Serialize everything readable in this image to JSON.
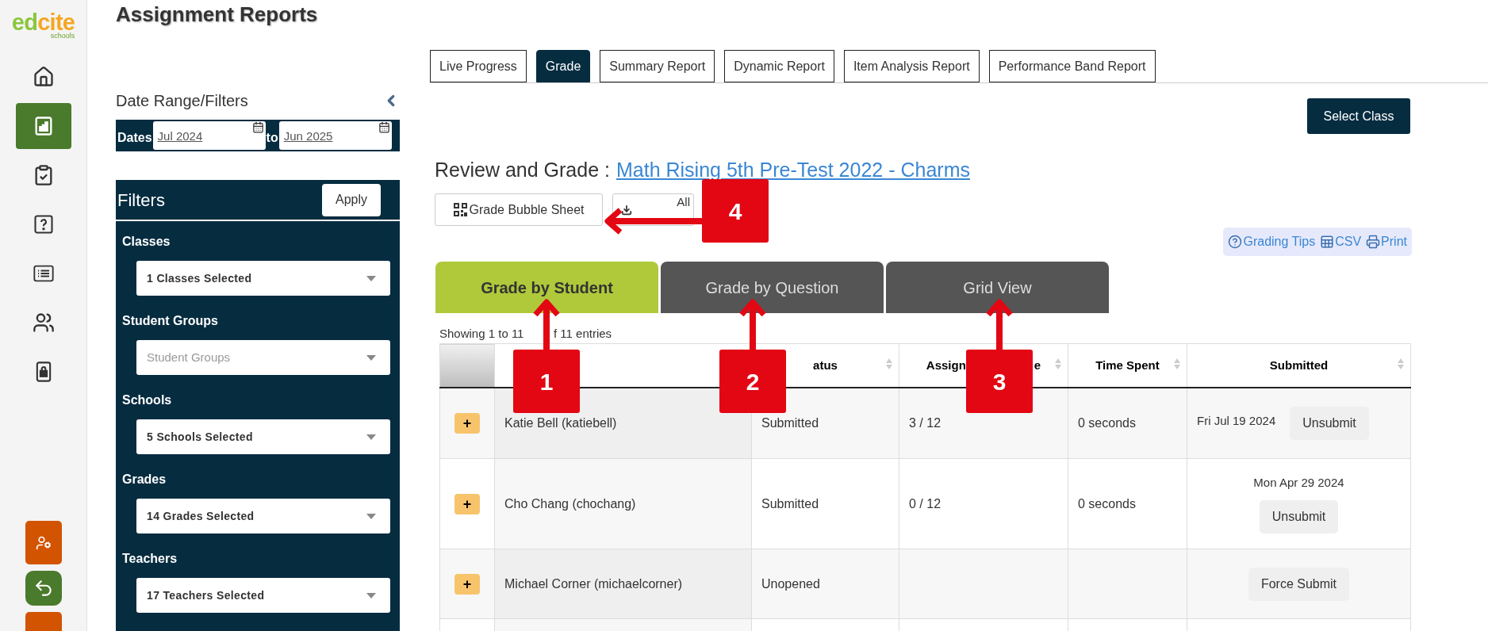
{
  "logo": {
    "name": "edcite",
    "tagline": "schools"
  },
  "sidebar": {
    "items": [
      {
        "selected": false
      },
      {
        "selected": true
      },
      {
        "selected": false
      },
      {
        "selected": false
      },
      {
        "selected": false
      },
      {
        "selected": false
      },
      {
        "selected": false
      }
    ]
  },
  "page_title": "Assignment Reports",
  "filters_panel": {
    "title": "Date Range/Filters",
    "dates_label": "Dates",
    "date_from": "Jul 2024",
    "date_to_label": "to",
    "date_to": "Jun 2025",
    "filters_title": "Filters",
    "apply_button": "Apply",
    "groups": [
      {
        "label": "Classes",
        "value": "1 Classes Selected"
      },
      {
        "label": "Student Groups",
        "placeholder": "Student Groups"
      },
      {
        "label": "Schools",
        "value": "5 Schools Selected"
      },
      {
        "label": "Grades",
        "value": "14 Grades Selected"
      },
      {
        "label": "Teachers",
        "value": "17 Teachers Selected"
      }
    ]
  },
  "report_tabs": [
    {
      "label": "Live Progress",
      "selected": false
    },
    {
      "label": "Grade",
      "selected": true
    },
    {
      "label": "Summary Report",
      "selected": false
    },
    {
      "label": "Dynamic Report",
      "selected": false
    },
    {
      "label": "Item Analysis Report",
      "selected": false
    },
    {
      "label": "Performance Band Report",
      "selected": false
    }
  ],
  "select_class_button": "Select Class",
  "review_heading": {
    "prefix": "Review and Grade :",
    "link": "Math Rising 5th Pre-Test 2022 - Charms"
  },
  "grade_bubble_sheet_button": "Grade Bubble Sheet",
  "open_all_button": {
    "visible_text": "All"
  },
  "tools": [
    {
      "kind": "help",
      "label": "Grading Tips"
    },
    {
      "kind": "sheet",
      "label": "CSV"
    },
    {
      "kind": "printer",
      "label": "Print"
    }
  ],
  "view_tabs": [
    {
      "label": "Grade by Student",
      "selected": true
    },
    {
      "label": "Grade by Question",
      "selected": false
    },
    {
      "label": "Grid View",
      "selected": false
    }
  ],
  "entries_info": [
    "Showing 1 to 11",
    "f 11 entries"
  ],
  "table": {
    "columns": [
      {
        "kind": "select",
        "sortable": false
      },
      {
        "kind": "blank",
        "sortable": false
      },
      {
        "kind": "text",
        "label": "atus",
        "sortable": true
      },
      {
        "kind": "split",
        "parts": [
          "Assign",
          "e"
        ],
        "sortable": true
      },
      {
        "kind": "text",
        "label": "Time Spent",
        "sortable": true
      },
      {
        "kind": "text",
        "label": "Submitted",
        "sortable": true
      }
    ],
    "rows": [
      {
        "expand": "+",
        "student": "Katie Bell (katiebell)",
        "status": "Submitted",
        "score": "3 / 12",
        "time_spent": "0 seconds",
        "submitted": {
          "kind": "inline",
          "date": "Fri Jul 19 2024",
          "action": "Unsubmit"
        }
      },
      {
        "expand": "+",
        "student": "Cho Chang (chochang)",
        "status": "Submitted",
        "score": "0 / 12",
        "time_spent": "0 seconds",
        "submitted": {
          "kind": "stacked",
          "date": "Mon Apr 29 2024",
          "action": "Unsubmit"
        }
      },
      {
        "expand": "+",
        "student": "Michael Corner (michaelcorner)",
        "status": "Unopened",
        "submitted": {
          "kind": "action",
          "action": "Force Submit"
        }
      }
    ]
  },
  "callouts": [
    {
      "number": "1"
    },
    {
      "number": "2"
    },
    {
      "number": "3"
    },
    {
      "number": "4"
    }
  ]
}
